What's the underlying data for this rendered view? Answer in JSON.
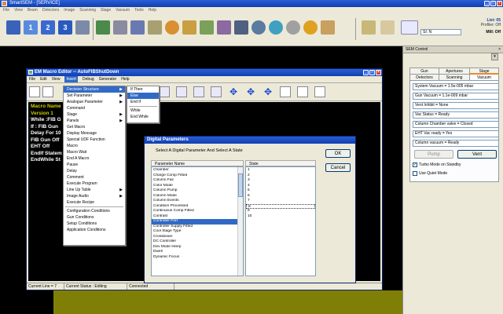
{
  "app": {
    "title": "SmartSEM - [SERVICE]",
    "menu": [
      "File",
      "View",
      "Beam",
      "Detectors",
      "Image",
      "Scanning",
      "Stage",
      "Vacuum",
      "Tools",
      "Help"
    ]
  },
  "toolbar": {
    "list_label": "List: 05",
    "list_sub": "Profiler: Off",
    "select_value": "SI: N",
    "mill_label": "Mill: Off"
  },
  "sem_control": {
    "title": "SEM Control",
    "tabs_row1": [
      "Gun",
      "Apertures",
      "Stage"
    ],
    "tabs_row2": [
      "Detectors",
      "Scanning",
      "Vacuum"
    ],
    "fields": [
      "System Vacuum = 1.5e-005 mbar",
      "Gun Vacuum = 1.1e-009 mbar",
      "Vent Inhibit = None",
      "Vac Status = Ready",
      "Column Chamber valve = Closed",
      "EHT Vac ready = Yes",
      "Column vacuum = Ready"
    ],
    "pump_label": "Pump",
    "vent_label": "Vent",
    "check1": "Turbo Mode on Standby",
    "check2": "Use Quiet Mode"
  },
  "macro_editor": {
    "title": "EM Macro Editor -- AutoFIBShutDown",
    "menu": [
      "File",
      "Edit",
      "View",
      "Insert",
      "Debug",
      "Generator",
      "Help"
    ],
    "content": [
      "Macro Name",
      "Version 1",
      "While :FIB G",
      "If : FIB Gun",
      "Delay For 10",
      "FIB Gun Off",
      "EHT Off",
      "EndIf Statem",
      "EndWhile St"
    ],
    "status": [
      "Current Line = 7",
      "Current Status : Editing",
      "Connected"
    ]
  },
  "insert_menu": {
    "items": [
      {
        "label": "Decision Structure",
        "arrow": true,
        "selected": true
      },
      {
        "label": "Set Parameter",
        "arrow": true
      },
      {
        "label": "Analogue Parameter",
        "arrow": true
      },
      {
        "label": "Command",
        "arrow": false
      },
      {
        "label": "Stage",
        "arrow": true
      },
      {
        "label": "Panels",
        "arrow": true
      },
      {
        "label": "Get Macro",
        "arrow": false
      },
      {
        "label": "Display Message",
        "arrow": false
      },
      {
        "label": "Special UDF Function",
        "arrow": false
      },
      {
        "label": "Macro",
        "arrow": false
      },
      {
        "label": "Macro Wait",
        "arrow": false
      },
      {
        "label": "End A Macro",
        "arrow": false
      },
      {
        "label": "Pause",
        "arrow": false
      },
      {
        "label": "Delay",
        "arrow": false
      },
      {
        "label": "Comment",
        "arrow": false
      },
      {
        "label": "Execute Program",
        "arrow": false
      },
      {
        "label": "Line Up Table",
        "arrow": true
      },
      {
        "label": "Image Audio",
        "arrow": true
      },
      {
        "label": "Execute Recipe",
        "arrow": false
      },
      {
        "label": "Configuration Conditions",
        "arrow": false,
        "sep_before": true
      },
      {
        "label": "Gun Conditions",
        "arrow": false
      },
      {
        "label": "Setup Conditions",
        "arrow": false
      },
      {
        "label": "Application Conditions",
        "arrow": false
      }
    ]
  },
  "decision_submenu": {
    "items": [
      {
        "label": "If Then",
        "selected": false
      },
      {
        "label": "Else",
        "selected": true
      },
      {
        "label": "End If",
        "selected": false
      },
      {
        "label": "While",
        "selected": false,
        "sep_before": true
      },
      {
        "label": "End While",
        "selected": false
      }
    ]
  },
  "digital_dialog": {
    "title": "Digital Parameters",
    "instruction": "Select A Digital Parameter And Select A State",
    "ok_label": "OK",
    "cancel_label": "Cancel",
    "param_header": "Parameter Name",
    "state_header": "State",
    "params": [
      "Chamber",
      "Charge Comp Fitted",
      "Column Fail",
      "Color Mode",
      "Column Pump",
      "Column Mode",
      "Column Events",
      "Condition Processed",
      "Continuous Comp Fitted",
      "Contrast",
      "Controller Port",
      "Controller Supply Fitted",
      "Cool Stage Type",
      "Crossbeam",
      "DC Controller",
      "Dev Mode Interp",
      "Dwell",
      "Dynamic Focus"
    ],
    "param_selected": 10,
    "states": [
      "1",
      "2",
      "3",
      "4",
      "5",
      "6",
      "7",
      "8",
      "9",
      "10"
    ],
    "state_selected": 7
  },
  "colors": {
    "titlebar": "#1d4fc8",
    "selection": "#316ac5",
    "olive": "#7f7f08",
    "macro_text": "#cccc00"
  }
}
